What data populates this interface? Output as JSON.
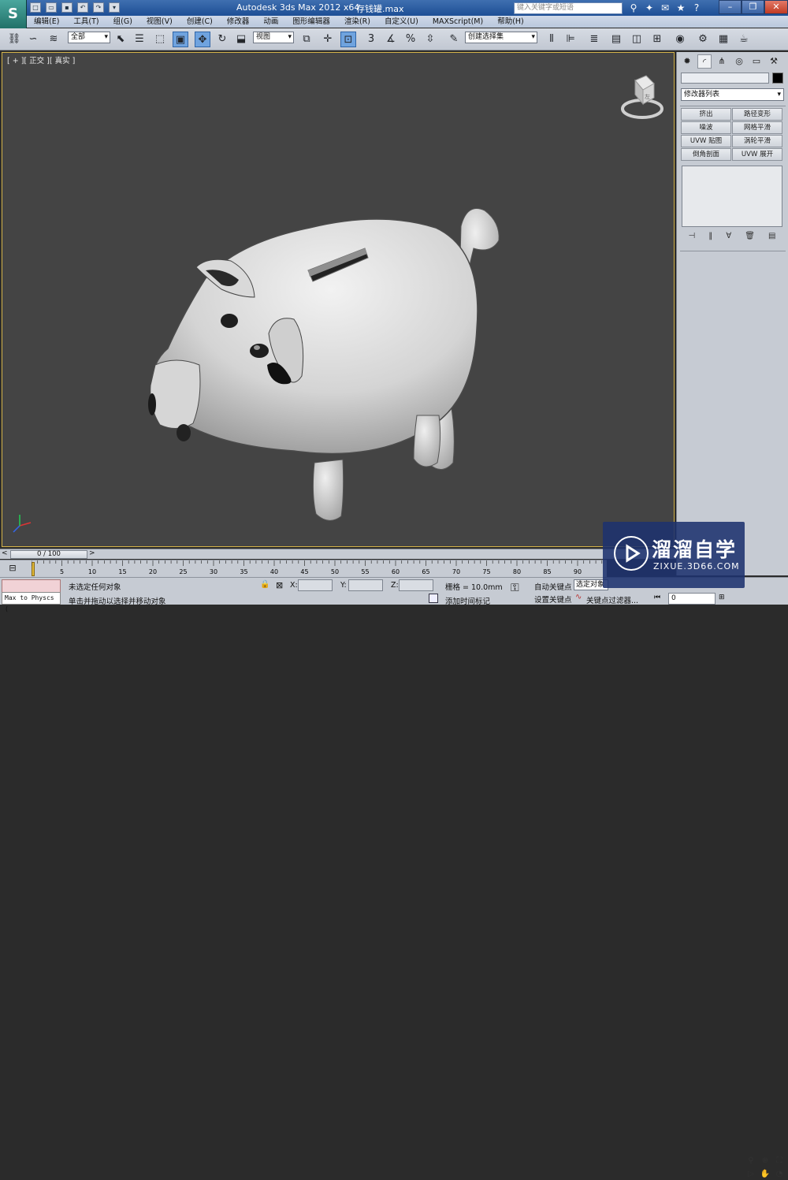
{
  "title_bar": {
    "app_title": "Autodesk 3ds Max  2012 x64",
    "file_name": "存钱罐.max",
    "search_placeholder": "键入关键字或短语",
    "help_icon": "?"
  },
  "menu": [
    "编辑(E)",
    "工具(T)",
    "组(G)",
    "视图(V)",
    "创建(C)",
    "修改器",
    "动画",
    "图形编辑器",
    "渲染(R)",
    "自定义(U)",
    "MAXScript(M)",
    "帮助(H)"
  ],
  "toolbar": {
    "selection_filter": "全部",
    "ref_coord": "视图",
    "named_selection": "创建选择集"
  },
  "viewport": {
    "label": "[ + ][ 正交 ][ 真实 ]",
    "cube_face": "左"
  },
  "command_panel": {
    "modifier_list": "修改器列表",
    "modifier_buttons": [
      [
        "挤出",
        "路径变形"
      ],
      [
        "噪波",
        "网格平滑"
      ],
      [
        "UVW 贴图",
        "涡轮平滑"
      ],
      [
        "倒角剖面",
        "UVW 展开"
      ]
    ]
  },
  "time": {
    "slider": "0 / 100",
    "ticks": [
      "5",
      "10",
      "15",
      "20",
      "25",
      "30",
      "35",
      "40",
      "45",
      "50",
      "55",
      "60",
      "65",
      "70",
      "75",
      "80",
      "85",
      "90"
    ]
  },
  "status": {
    "maxscript": "Max to Physcs (",
    "selection_status": "未选定任何对象",
    "prompt": "单击并拖动以选择并移动对象",
    "x_label": "X:",
    "y_label": "Y:",
    "z_label": "Z:",
    "grid": "栅格 = 10.0mm",
    "add_time_tag": "添加时间标记",
    "auto_key": "自动关键点",
    "set_key": "设置关键点",
    "key_mode": "选定对象",
    "key_filters": "关键点过滤器...",
    "frame": "0"
  },
  "watermark": {
    "line1": "溜溜自学",
    "line2": "ZIXUE.3D66.COM"
  },
  "colors": {
    "viewport_bg": "#444444",
    "ui_gray": "#c6cbd3",
    "title_blue": "#1d4f95",
    "active_border": "#d5b44a"
  }
}
